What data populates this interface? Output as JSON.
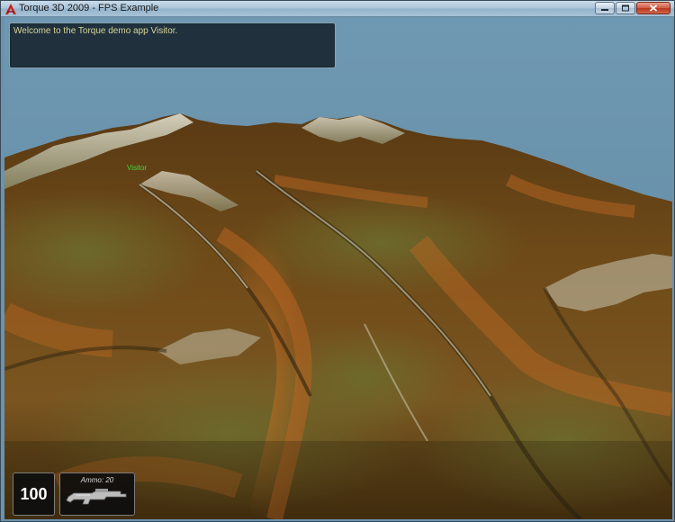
{
  "window": {
    "title": "Torque 3D 2009 - FPS Example",
    "icon": "torque-logo-icon",
    "buttons": [
      "minimize-icon",
      "maximize-icon",
      "close-icon"
    ]
  },
  "chat": {
    "message": "Welcome to the Torque demo app Visitor."
  },
  "player": {
    "nametag": "Visitor"
  },
  "hud": {
    "health": "100",
    "ammo_label": "Ammo: 20",
    "weapon_icon": "rifle-icon"
  },
  "colors": {
    "sky": "#6a93ad",
    "terrain_dirt": "#9a5a1e",
    "terrain_moss": "#5c5a22",
    "chat_text": "#d8d49a",
    "nametag": "#3ed63e"
  }
}
